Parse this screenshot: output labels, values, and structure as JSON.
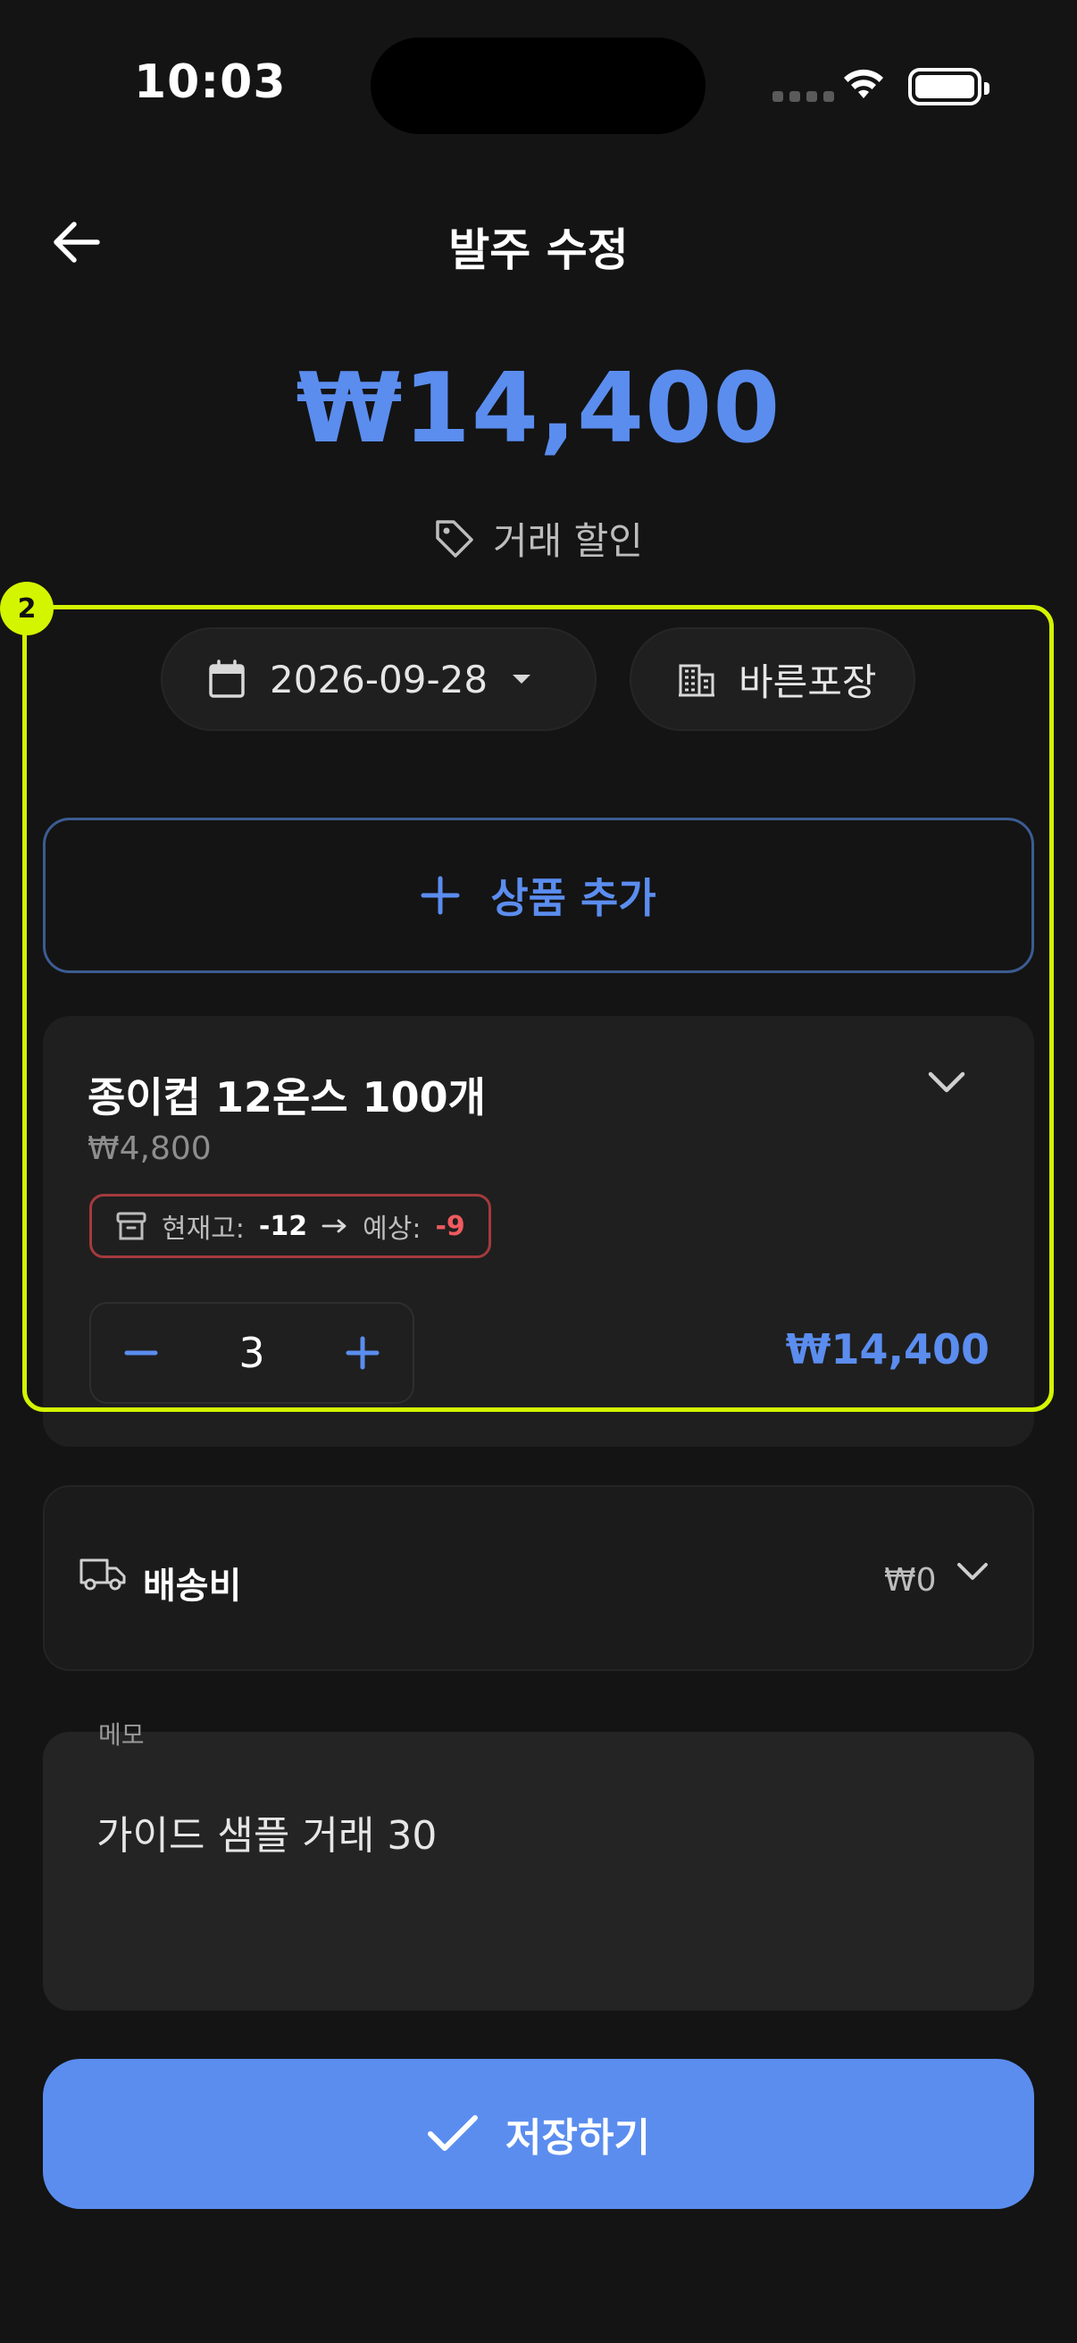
{
  "status_bar": {
    "time": "10:03"
  },
  "header": {
    "title": "발주 수정",
    "back_icon": "arrow-left-icon"
  },
  "total": "₩14,400",
  "discount": {
    "label": "거래 할인",
    "icon": "tag-icon"
  },
  "highlight": {
    "badge": "2"
  },
  "chips": {
    "date": {
      "value": "2026-09-28",
      "icon": "calendar-icon"
    },
    "vendor": {
      "value": "바른포장",
      "icon": "building-icon"
    }
  },
  "add_product": {
    "label": "상품 추가",
    "icon": "plus-icon"
  },
  "item": {
    "name": "종이컵 12온스 100개",
    "price": "₩4,800",
    "stock": {
      "current_label": "현재고:",
      "current_value": "-12",
      "expected_label": "예상:",
      "expected_value": "-9"
    },
    "quantity": "3",
    "line_total": "₩14,400"
  },
  "shipping": {
    "label": "배송비",
    "value": "₩0",
    "icon": "truck-icon"
  },
  "memo": {
    "label": "메모",
    "value": "가이드 샘플 거래 30"
  },
  "save": {
    "label": "저장하기",
    "icon": "check-icon"
  },
  "colors": {
    "accent": "#5b8def",
    "highlight": "#d4f500",
    "negative": "#ef5a5f",
    "background": "#141414"
  }
}
